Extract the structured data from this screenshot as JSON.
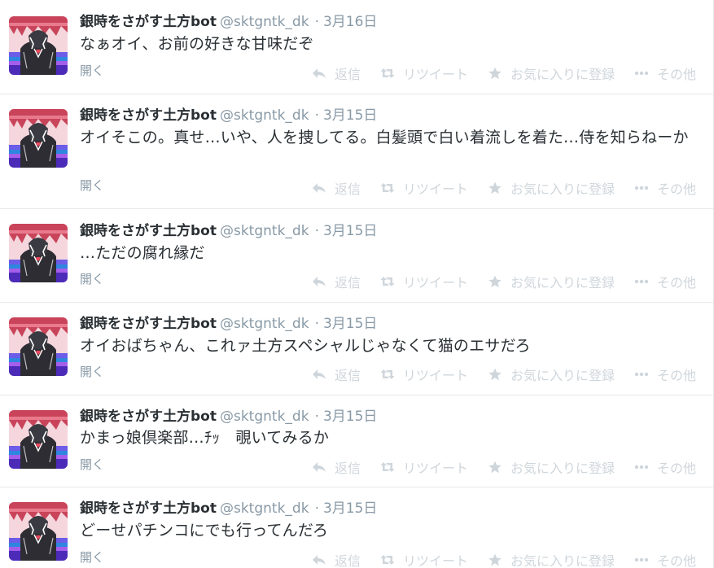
{
  "labels": {
    "expand": "開く",
    "reply": "返信",
    "retweet": "リツイート",
    "favorite": "お気に入りに登録",
    "more": "その他"
  },
  "icons": {
    "avatar": "profile-avatar",
    "reply": "reply-arrow-icon",
    "retweet": "retweet-arrows-icon",
    "favorite": "star-icon",
    "more": "ellipsis-icon"
  },
  "colors": {
    "muted": "#8899a6",
    "action": "#cfd6db",
    "text": "#292f33"
  },
  "tweets": [
    {
      "display_name": "銀時をさがす土方bot",
      "screen_name": "@sktgntk_dk",
      "time": "3月16日",
      "text": "なぁオイ、お前の好きな甘味だぞ"
    },
    {
      "display_name": "銀時をさがす土方bot",
      "screen_name": "@sktgntk_dk",
      "time": "3月15日",
      "text": "オイそこの。真せ…いや、人を捜してる。白髪頭で白い着流しを着た…侍を知らねーか"
    },
    {
      "display_name": "銀時をさがす土方bot",
      "screen_name": "@sktgntk_dk",
      "time": "3月15日",
      "text": "…ただの腐れ縁だ"
    },
    {
      "display_name": "銀時をさがす土方bot",
      "screen_name": "@sktgntk_dk",
      "time": "3月15日",
      "text": "オイおばちゃん、これァ土方スペシャルじゃなくて猫のエサだろ"
    },
    {
      "display_name": "銀時をさがす土方bot",
      "screen_name": "@sktgntk_dk",
      "time": "3月15日",
      "text": "かまっ娘倶楽部…ﾁｯ　覗いてみるか"
    },
    {
      "display_name": "銀時をさがす土方bot",
      "screen_name": "@sktgntk_dk",
      "time": "3月15日",
      "text": "どーせパチンコにでも行ってんだろ"
    }
  ]
}
